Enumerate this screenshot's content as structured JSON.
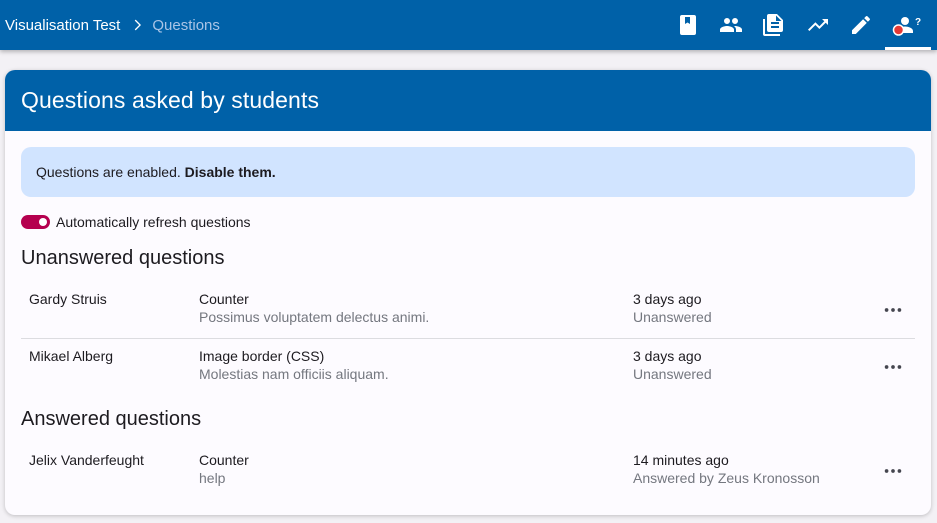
{
  "breadcrumb": {
    "course": "Visualisation Test",
    "current": "Questions"
  },
  "nav": {
    "icons": [
      "book-icon",
      "people-icon",
      "document-icon",
      "trending-up-icon",
      "edit-pencil-icon",
      "questions-person-icon"
    ],
    "active": "questions-person-icon",
    "badge_color": "#e53935"
  },
  "card": {
    "title": "Questions asked by students"
  },
  "alert": {
    "text": "Questions are enabled.",
    "link": "Disable them."
  },
  "auto_refresh": {
    "label": "Automatically refresh questions",
    "enabled": true
  },
  "unanswered": {
    "title": "Unanswered questions",
    "rows": [
      {
        "student": "Gardy Struis",
        "exercise": "Counter",
        "question": "Possimus voluptatem delectus animi.",
        "time": "3 days ago",
        "status": "Unanswered"
      },
      {
        "student": "Mikael Alberg",
        "exercise": "Image border (CSS)",
        "question": "Molestias nam officiis aliquam.",
        "time": "3 days ago",
        "status": "Unanswered"
      }
    ]
  },
  "answered": {
    "title": "Answered questions",
    "rows": [
      {
        "student": "Jelix Vanderfeught",
        "exercise": "Counter",
        "question": "help",
        "time": "14 minutes ago",
        "status": "Answered by Zeus Kronosson"
      }
    ]
  },
  "colors": {
    "primary": "#0061a8",
    "alert_bg": "#d1e4ff",
    "toggle": "#b5004f"
  }
}
